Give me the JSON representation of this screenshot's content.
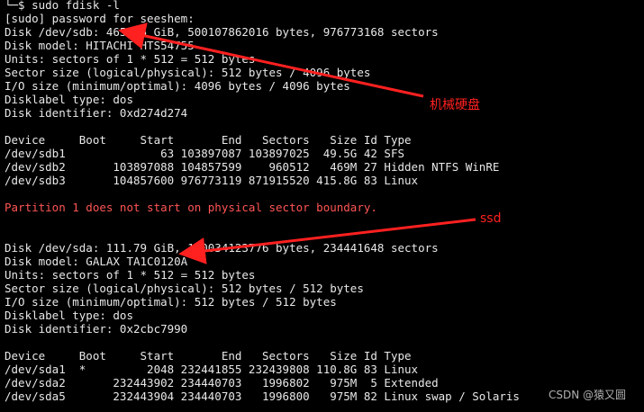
{
  "terminal": {
    "lines": [
      {
        "text": "└─$ sudo fdisk -l",
        "kind": "prompt"
      },
      {
        "text": "[sudo] password for seeshem:",
        "kind": "normal"
      },
      {
        "text": "Disk /dev/sdb: 465.76 GiB, 500107862016 bytes, 976773168 sectors",
        "kind": "normal"
      },
      {
        "text": "Disk model: HITACHI HTS54755",
        "kind": "normal"
      },
      {
        "text": "Units: sectors of 1 * 512 = 512 bytes",
        "kind": "normal"
      },
      {
        "text": "Sector size (logical/physical): 512 bytes / 4096 bytes",
        "kind": "normal"
      },
      {
        "text": "I/O size (minimum/optimal): 4096 bytes / 4096 bytes",
        "kind": "normal"
      },
      {
        "text": "Disklabel type: dos",
        "kind": "normal"
      },
      {
        "text": "Disk identifier: 0xd274d274",
        "kind": "normal"
      },
      {
        "text": "",
        "kind": "normal"
      },
      {
        "text": "Device     Boot     Start       End   Sectors   Size Id Type",
        "kind": "normal"
      },
      {
        "text": "/dev/sdb1              63 103897087 103897025  49.5G 42 SFS",
        "kind": "normal"
      },
      {
        "text": "/dev/sdb2       103897088 104857599    960512   469M 27 Hidden NTFS WinRE",
        "kind": "normal"
      },
      {
        "text": "/dev/sdb3       104857600 976773119 871915520 415.8G 83 Linux",
        "kind": "normal"
      },
      {
        "text": "",
        "kind": "normal"
      },
      {
        "text": "Partition 1 does not start on physical sector boundary.",
        "kind": "error"
      },
      {
        "text": "",
        "kind": "normal"
      },
      {
        "text": "",
        "kind": "normal"
      },
      {
        "text": "Disk /dev/sda: 111.79 GiB, 120034123776 bytes, 234441648 sectors",
        "kind": "normal"
      },
      {
        "text": "Disk model: GALAX TA1C0120A",
        "kind": "normal"
      },
      {
        "text": "Units: sectors of 1 * 512 = 512 bytes",
        "kind": "normal"
      },
      {
        "text": "Sector size (logical/physical): 512 bytes / 512 bytes",
        "kind": "normal"
      },
      {
        "text": "I/O size (minimum/optimal): 512 bytes / 512 bytes",
        "kind": "normal"
      },
      {
        "text": "Disklabel type: dos",
        "kind": "normal"
      },
      {
        "text": "Disk identifier: 0x2cbc7990",
        "kind": "normal"
      },
      {
        "text": "",
        "kind": "normal"
      },
      {
        "text": "Device     Boot     Start       End   Sectors   Size Id Type",
        "kind": "normal"
      },
      {
        "text": "/dev/sda1  *         2048 232441855 232439808 110.8G 83 Linux",
        "kind": "normal"
      },
      {
        "text": "/dev/sda2       232443902 234440703   1996802   975M  5 Extended",
        "kind": "normal"
      },
      {
        "text": "/dev/sda5       232443904 234440703   1996800   975M 82 Linux swap / Solaris",
        "kind": "normal"
      }
    ]
  },
  "annotations": {
    "hdd_label": "机械硬盘",
    "ssd_label": "ssd",
    "color": "#ff2020"
  },
  "watermark": "CSDN @猿又圆",
  "colors": {
    "background": "#000000",
    "text": "#e8e8e8",
    "error": "#ff5555"
  }
}
